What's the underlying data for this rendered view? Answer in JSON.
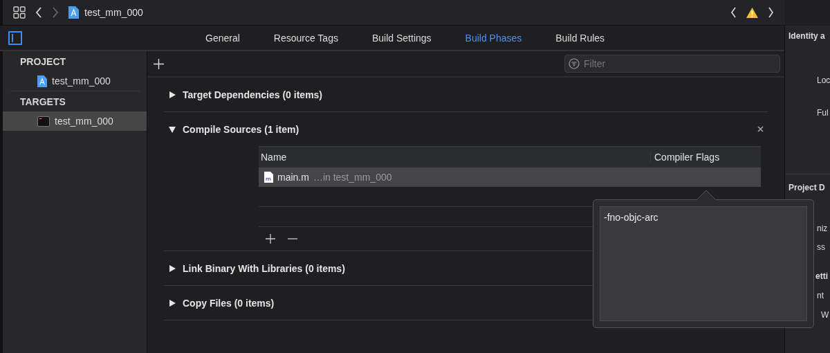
{
  "toolbar": {
    "file_title": "test_mm_000"
  },
  "tabs": [
    {
      "label": "General",
      "selected": false
    },
    {
      "label": "Resource Tags",
      "selected": false
    },
    {
      "label": "Build Settings",
      "selected": false
    },
    {
      "label": "Build Phases",
      "selected": true
    },
    {
      "label": "Build Rules",
      "selected": false
    }
  ],
  "sidebar": {
    "groups": [
      {
        "heading": "PROJECT",
        "items": [
          {
            "label": "test_mm_000",
            "kind": "project",
            "selected": false
          }
        ]
      },
      {
        "heading": "TARGETS",
        "items": [
          {
            "label": "test_mm_000",
            "kind": "target",
            "selected": true
          }
        ]
      }
    ]
  },
  "filter": {
    "placeholder": "Filter"
  },
  "phases": [
    {
      "title": "Target Dependencies (0 items)",
      "expanded": false
    },
    {
      "title": "Compile Sources (1 item)",
      "expanded": true,
      "table": {
        "columns": [
          "Name",
          "Compiler Flags"
        ],
        "rows": [
          {
            "name": "main.m",
            "location": "…in test_mm_000",
            "selected": true
          }
        ]
      }
    },
    {
      "title": "Link Binary With Libraries (0 items)",
      "expanded": false
    },
    {
      "title": "Copy Files (0 items)",
      "expanded": false
    }
  ],
  "popover": {
    "value": "-fno-objc-arc"
  },
  "inspector": {
    "lines": [
      {
        "text": "Identity a",
        "kind": "heading"
      },
      {
        "text": "Loc",
        "kind": "label"
      },
      {
        "text": "Ful",
        "kind": "label"
      },
      {
        "text": "Project D",
        "kind": "heading"
      },
      {
        "text": "niz",
        "kind": "label"
      },
      {
        "text": "ss",
        "kind": "label"
      },
      {
        "text": "etti",
        "kind": "heading"
      },
      {
        "text": "nt",
        "kind": "label"
      },
      {
        "text": "W",
        "kind": "label"
      }
    ]
  }
}
